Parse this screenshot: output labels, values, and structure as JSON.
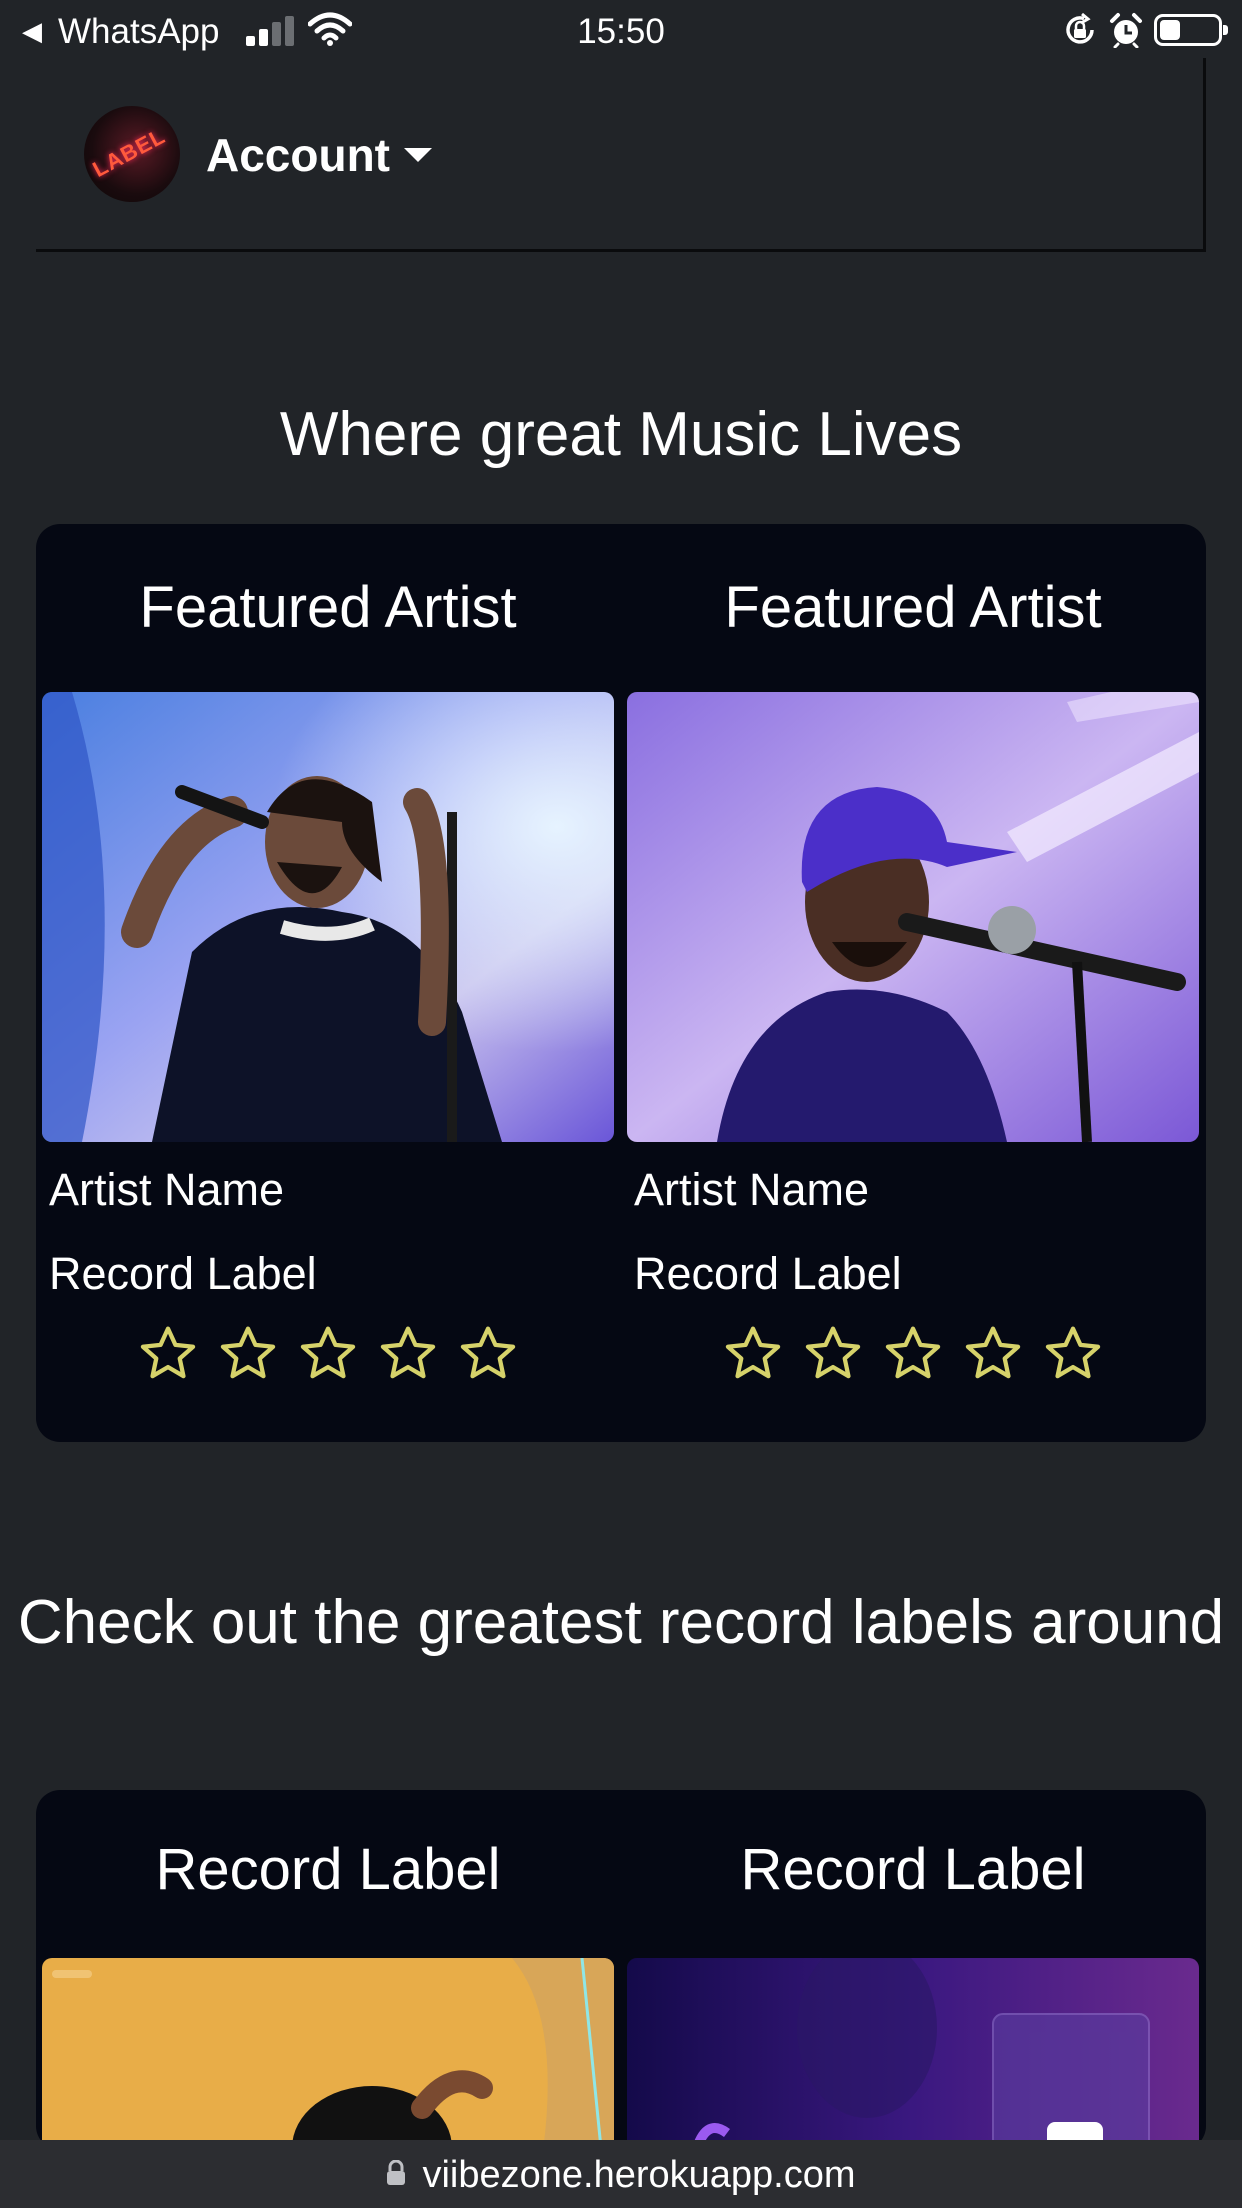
{
  "status_bar": {
    "back_app": "WhatsApp",
    "back_icon": "back-arrow-icon",
    "time": "15:50",
    "battery_level": 0.35
  },
  "navbar": {
    "avatar_text": "LABEL",
    "account_label": "Account"
  },
  "hero": {
    "title": "Where great Music Lives"
  },
  "featured_artists": [
    {
      "title": "Featured Artist",
      "name": "Artist Name",
      "label": "Record Label",
      "rating": 0,
      "max_rating": 5
    },
    {
      "title": "Featured Artist",
      "name": "Artist Name",
      "label": "Record Label",
      "rating": 0,
      "max_rating": 5
    }
  ],
  "labels_section": {
    "title": "Check out the greatest record labels around"
  },
  "record_labels": [
    {
      "title": "Record Label"
    },
    {
      "title": "Record Label"
    }
  ],
  "browser": {
    "url": "viibezone.herokuapp.com"
  },
  "colors": {
    "background": "#212428",
    "panel": "#050813",
    "star": "#d6d26a"
  }
}
